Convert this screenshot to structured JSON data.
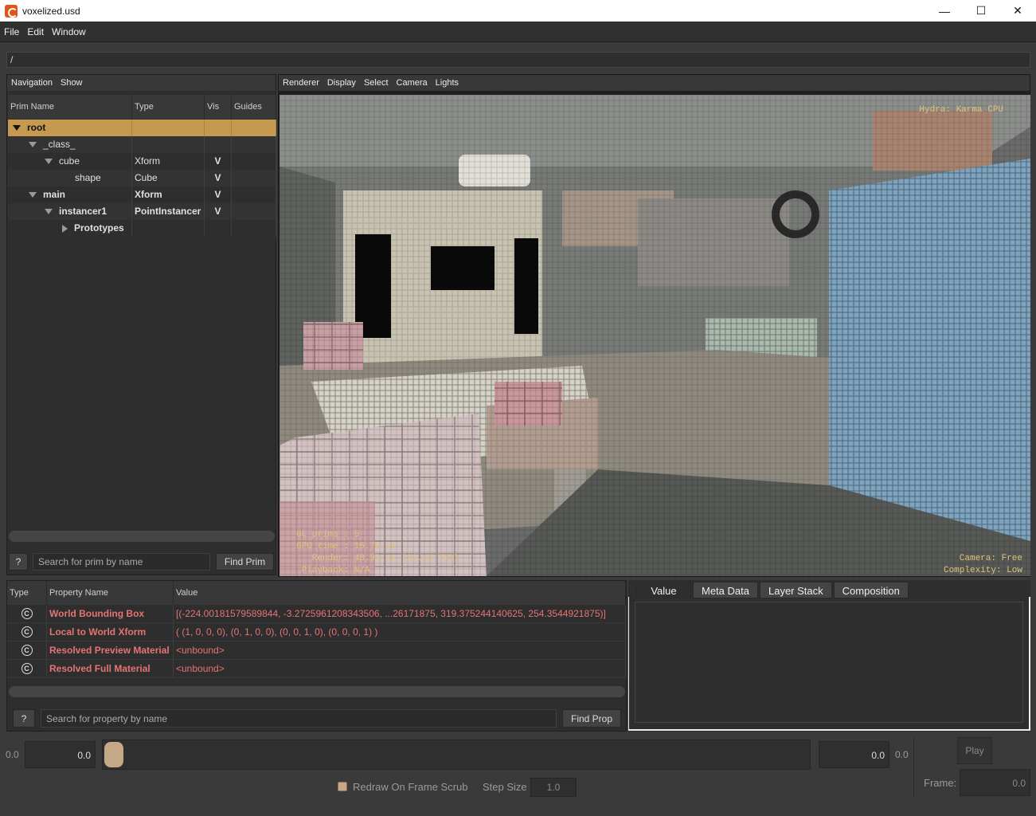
{
  "window": {
    "title": "voxelized.usd",
    "minimize": "—",
    "maximize": "☐",
    "close": "✕"
  },
  "menubar": {
    "items": [
      "File",
      "Edit",
      "Window"
    ]
  },
  "path": "/",
  "prim_panel": {
    "menu": [
      "Navigation",
      "Show"
    ],
    "columns": [
      "Prim Name",
      "Type",
      "Vis",
      "Guides"
    ],
    "rows": [
      {
        "name": "root",
        "type": "",
        "vis": "",
        "guides": ""
      },
      {
        "name": "_class_",
        "type": "",
        "vis": "",
        "guides": ""
      },
      {
        "name": "cube",
        "type": "Xform",
        "vis": "V",
        "guides": ""
      },
      {
        "name": "shape",
        "type": "Cube",
        "vis": "V",
        "guides": ""
      },
      {
        "name": "main",
        "type": "Xform",
        "vis": "V",
        "guides": ""
      },
      {
        "name": "instancer1",
        "type": "PointInstancer",
        "vis": "V",
        "guides": ""
      },
      {
        "name": "Prototypes",
        "type": "",
        "vis": "",
        "guides": ""
      }
    ],
    "help_label": "?",
    "search_placeholder": "Search for prim by name",
    "find_label": "Find Prim"
  },
  "viewport": {
    "menu": [
      "Renderer",
      "Display",
      "Select",
      "Camera",
      "Lights"
    ],
    "hud_top_right": "Hydra: Karma CPU",
    "hud_bottom_left": "GL prims : 5\nGPU time : 16.76 ms\n   Render: 48.95 ms (20.43 FPS)\n Playback: N/A",
    "hud_bottom_right": "Camera: Free\nComplexity: Low"
  },
  "property_panel": {
    "columns": [
      "Type",
      "Property Name",
      "Value"
    ],
    "rows": [
      {
        "icon": "C",
        "name": "World Bounding Box",
        "value": "[(-224.00181579589844, -3.2725961208343506, ...26171875, 319.375244140625, 254.3544921875)]"
      },
      {
        "icon": "C",
        "name": "Local to World Xform",
        "value": "( (1, 0, 0, 0), (0, 1, 0, 0), (0, 0, 1, 0), (0, 0, 0, 1) )"
      },
      {
        "icon": "C",
        "name": "Resolved Preview Material",
        "value": "<unbound>"
      },
      {
        "icon": "C",
        "name": "Resolved Full Material",
        "value": "<unbound>"
      }
    ],
    "help_label": "?",
    "search_placeholder": "Search for property by name",
    "find_label": "Find Prop"
  },
  "value_panel": {
    "tabs": [
      "Value",
      "Meta Data",
      "Layer Stack",
      "Composition"
    ]
  },
  "timeline": {
    "start_label": "0.0",
    "start_value": "0.0",
    "end_value": "0.0",
    "end_label": "0.0",
    "play_label": "Play",
    "redraw_label": "Redraw On Frame Scrub",
    "step_label": "Step Size",
    "step_value": "1.0",
    "frame_label": "Frame:",
    "frame_value": "0.0"
  },
  "colors": {
    "selection": "#c59a50",
    "property_text": "#e57474",
    "hud_text": "#e3c27a",
    "slider_handle": "#c5a887"
  }
}
